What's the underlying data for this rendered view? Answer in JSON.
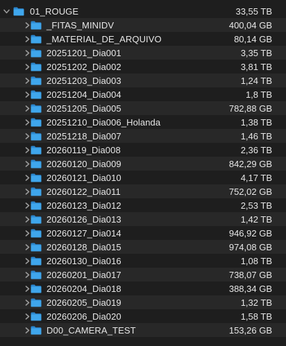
{
  "colors": {
    "background": "#1e1e1e",
    "stripe": "#282828",
    "text": "#e6e6e6",
    "chevron": "#9a9a9a",
    "folder_front": "#3fa6ec",
    "folder_back": "#2b87cf"
  },
  "icons": {
    "expanded": "chevron-down-icon",
    "collapsed": "chevron-right-icon",
    "item": "folder-icon"
  },
  "root": {
    "name": "01_ROUGE",
    "size": "33,55 TB",
    "expanded": true
  },
  "children": [
    {
      "name": "_FITAS_MINIDV",
      "size": "400,04 GB"
    },
    {
      "name": "_MATERIAL_DE_ARQUIVO",
      "size": "80,14 GB"
    },
    {
      "name": "20251201_Dia001",
      "size": "3,35 TB"
    },
    {
      "name": "20251202_Dia002",
      "size": "3,81 TB"
    },
    {
      "name": "20251203_Dia003",
      "size": "1,24 TB"
    },
    {
      "name": "20251204_Dia004",
      "size": "1,8 TB"
    },
    {
      "name": "20251205_Dia005",
      "size": "782,88 GB"
    },
    {
      "name": "20251210_Dia006_Holanda",
      "size": "1,38 TB"
    },
    {
      "name": "20251218_Dia007",
      "size": "1,46 TB"
    },
    {
      "name": "20260119_Dia008",
      "size": "2,36 TB"
    },
    {
      "name": "20260120_Dia009",
      "size": "842,29 GB"
    },
    {
      "name": "20260121_Dia010",
      "size": "4,17 TB"
    },
    {
      "name": "20260122_Dia011",
      "size": "752,02 GB"
    },
    {
      "name": "20260123_Dia012",
      "size": "2,53 TB"
    },
    {
      "name": "20260126_Dia013",
      "size": "1,42 TB"
    },
    {
      "name": "20260127_Dia014",
      "size": "946,92 GB"
    },
    {
      "name": "20260128_Dia015",
      "size": "974,08 GB"
    },
    {
      "name": "20260130_Dia016",
      "size": "1,08 TB"
    },
    {
      "name": "20260201_Dia017",
      "size": "738,07 GB"
    },
    {
      "name": "20260204_Dia018",
      "size": "388,34 GB"
    },
    {
      "name": "20260205_Dia019",
      "size": "1,32 TB"
    },
    {
      "name": "20260206_Dia020",
      "size": "1,58 TB"
    },
    {
      "name": "D00_CAMERA_TEST",
      "size": "153,26 GB"
    }
  ]
}
